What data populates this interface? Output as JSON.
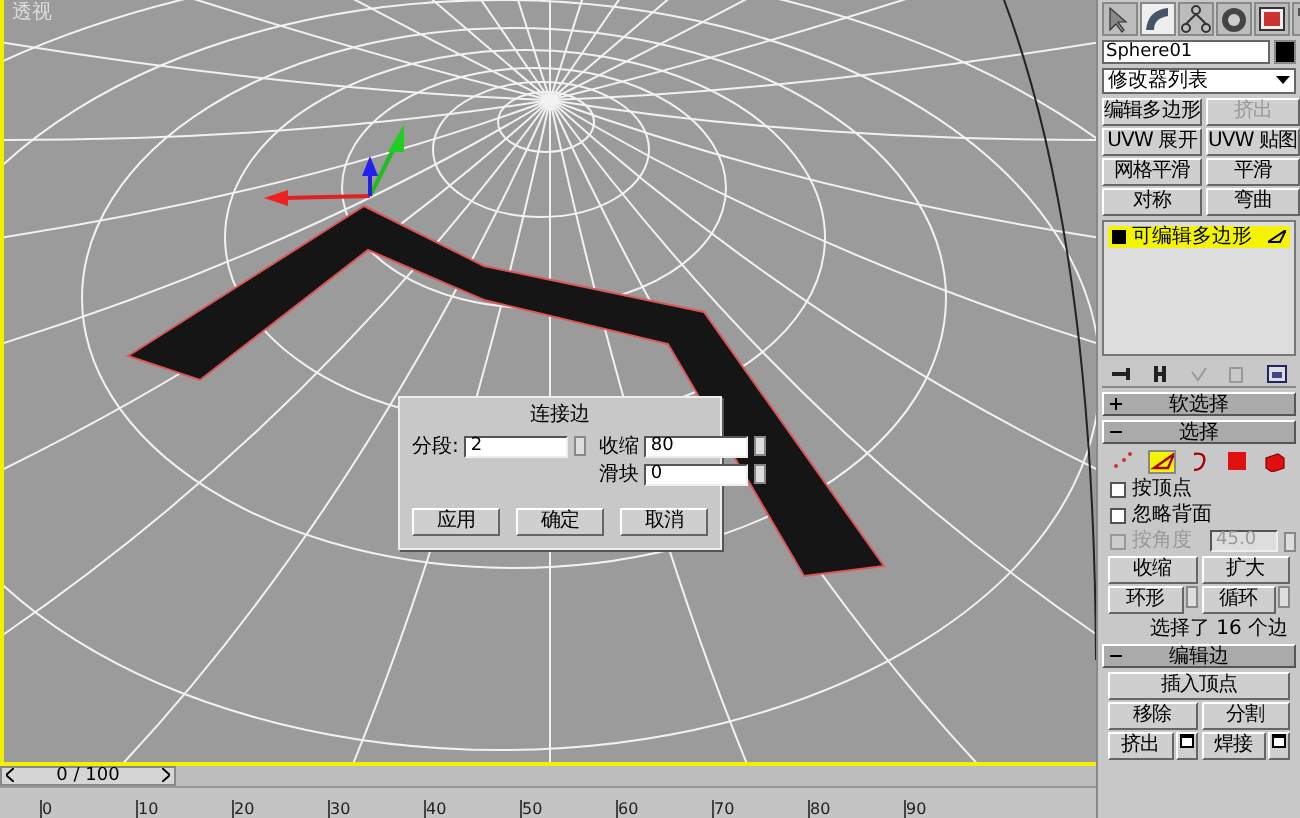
{
  "viewport": {
    "label": "透视"
  },
  "dialog": {
    "title": "连接边",
    "fields": [
      {
        "label": "分段:",
        "value": "2"
      },
      {
        "label": "收缩",
        "value": "80"
      },
      {
        "label": "滑块",
        "value": "0"
      }
    ],
    "buttons": [
      "应用",
      "确定",
      "取消"
    ]
  },
  "command_panel": {
    "tabs": [
      {
        "selected": false
      },
      {
        "selected": true
      },
      {
        "selected": false
      },
      {
        "selected": false
      },
      {
        "selected": false
      },
      {
        "selected": false
      }
    ],
    "object_name": "Sphere01",
    "modifier_list": "修改器列表",
    "modifier_buttons": [
      {
        "label": "编辑多边形",
        "disabled": false
      },
      {
        "label": "挤出",
        "disabled": true
      },
      {
        "label": "UVW 展开",
        "disabled": false
      },
      {
        "label": "UVW 贴图",
        "disabled": false
      },
      {
        "label": "网格平滑",
        "disabled": false
      },
      {
        "label": "平滑",
        "disabled": false
      },
      {
        "label": "对称",
        "disabled": false
      },
      {
        "label": "弯曲",
        "disabled": false
      }
    ],
    "stack": [
      {
        "label": "可编辑多边形",
        "selected": true
      }
    ],
    "rollouts": [
      {
        "title": "软选择",
        "expanded": false
      },
      {
        "title": "选择",
        "expanded": true,
        "subobjects": [
          {
            "kind": "vertex",
            "selected": false
          },
          {
            "kind": "edge",
            "selected": true
          },
          {
            "kind": "border",
            "selected": false
          },
          {
            "kind": "polygon",
            "selected": false
          },
          {
            "kind": "element",
            "selected": false
          }
        ],
        "checkboxes": [
          {
            "label": "按顶点",
            "checked": false,
            "disabled": false
          },
          {
            "label": "忽略背面",
            "checked": false,
            "disabled": false
          },
          {
            "label": "按角度",
            "checked": false,
            "disabled": true,
            "value": "45.0"
          }
        ],
        "buttons": [
          {
            "label": "收缩",
            "spinner": false
          },
          {
            "label": "扩大",
            "spinner": false
          },
          {
            "label": "环形",
            "spinner": true
          },
          {
            "label": "循环",
            "spinner": true
          }
        ],
        "status": "选择了 16 个边"
      },
      {
        "title": "编辑边",
        "expanded": true,
        "buttons": [
          {
            "label": "插入顶点",
            "wide": true,
            "settings": false
          },
          {
            "label": "移除",
            "wide": false,
            "settings": false
          },
          {
            "label": "分割",
            "wide": false,
            "settings": false
          },
          {
            "label": "挤出",
            "wide": false,
            "settings": true
          },
          {
            "label": "焊接",
            "wide": false,
            "settings": true
          }
        ]
      }
    ]
  },
  "timeline": {
    "frame": "0 / 100",
    "ticks": [
      "0",
      "10",
      "20",
      "30",
      "40",
      "50",
      "60",
      "70",
      "80",
      "90"
    ]
  }
}
